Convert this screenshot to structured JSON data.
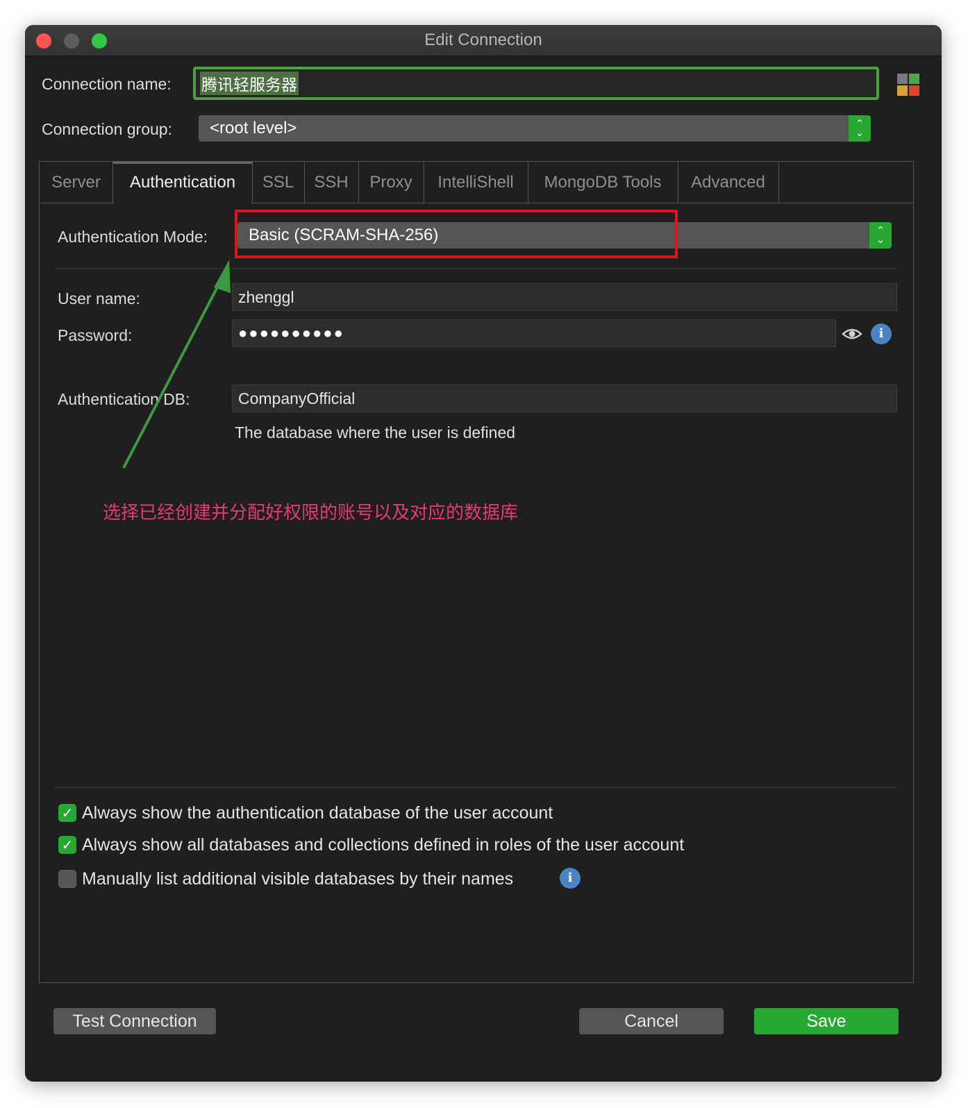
{
  "window": {
    "title": "Edit Connection"
  },
  "connection": {
    "name_label": "Connection name:",
    "name_value": "腾讯轻服务器",
    "group_label": "Connection group:",
    "group_value": "<root level>"
  },
  "tabs": [
    {
      "label": "Server"
    },
    {
      "label": "Authentication"
    },
    {
      "label": "SSL"
    },
    {
      "label": "SSH"
    },
    {
      "label": "Proxy"
    },
    {
      "label": "IntelliShell"
    },
    {
      "label": "MongoDB Tools"
    },
    {
      "label": "Advanced"
    }
  ],
  "auth": {
    "mode_label": "Authentication Mode:",
    "mode_value": "Basic (SCRAM-SHA-256)",
    "username_label": "User name:",
    "username_value": "zhenggl",
    "password_label": "Password:",
    "password_value": "●●●●●●●●●●",
    "db_label": "Authentication DB:",
    "db_value": "CompanyOfficial",
    "db_hint": "The database where the user is defined"
  },
  "annotation": {
    "text": "选择已经创建并分配好权限的账号以及对应的数据库"
  },
  "options": [
    {
      "label": "Always show the authentication database of the user account",
      "checked": true
    },
    {
      "label": "Always show all databases and collections defined in roles of the user account",
      "checked": true
    },
    {
      "label": "Manually list additional visible databases by their names",
      "checked": false
    }
  ],
  "buttons": {
    "test": "Test Connection",
    "cancel": "Cancel",
    "save": "Save"
  },
  "colors": {
    "accent_green": "#27a833",
    "highlight_red": "#e0141e",
    "annotation_pink": "#e8387a"
  }
}
